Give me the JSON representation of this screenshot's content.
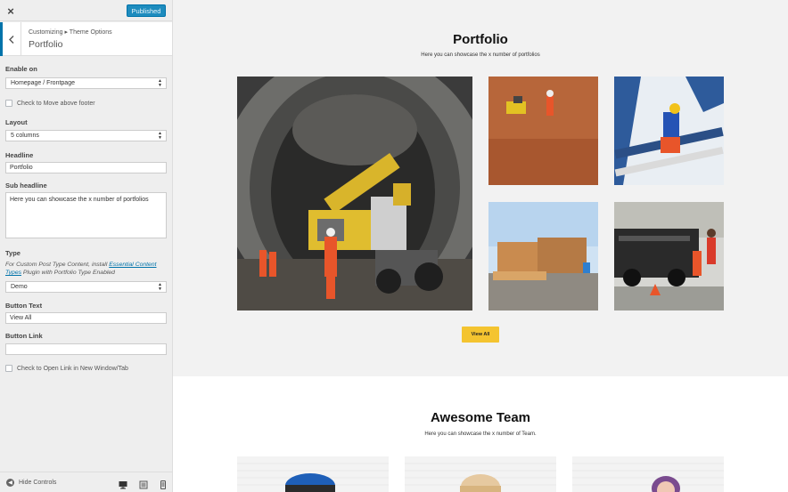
{
  "topbar": {
    "close_label": "×",
    "publish_label": "Published"
  },
  "section": {
    "breadcrumb": "Customizing ▸ Theme Options",
    "title": "Portfolio"
  },
  "controls": {
    "enable_on": {
      "label": "Enable on",
      "value": "Homepage / Frontpage"
    },
    "move_footer": {
      "label": "Check to Move above footer"
    },
    "layout": {
      "label": "Layout",
      "value": "5 columns"
    },
    "headline": {
      "label": "Headline",
      "value": "Portfolio"
    },
    "sub_headline": {
      "label": "Sub headline",
      "value": "Here you can showcase the x number of portfolios"
    },
    "type": {
      "label": "Type",
      "desc_prefix": "For Custom Post Type Content, install ",
      "desc_link": "Essential Content Types",
      "desc_suffix": " Plugin with Portfolio Type Enabled",
      "value": "Demo"
    },
    "button_text": {
      "label": "Button Text",
      "value": "View All"
    },
    "button_link": {
      "label": "Button Link",
      "value": ""
    },
    "new_window": {
      "label": "Check to Open Link in New Window/Tab"
    }
  },
  "footer": {
    "hide_controls": "Hide Controls"
  },
  "preview": {
    "portfolio": {
      "title": "Portfolio",
      "subtitle": "Here you can showcase the x number of portfolios",
      "button": "View All"
    },
    "team": {
      "title": "Awesome Team",
      "subtitle": "Here you can showcase the x number of Team."
    }
  },
  "colors": {
    "accent": "#0073aa",
    "publish": "#1e8cbe",
    "view_all": "#f4c430"
  }
}
